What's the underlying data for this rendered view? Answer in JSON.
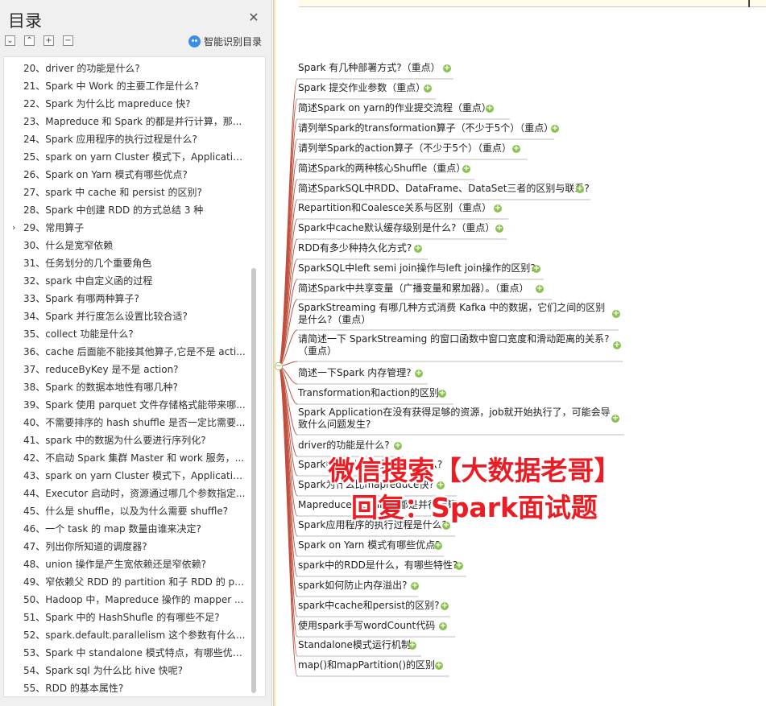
{
  "toc": {
    "title": "目录",
    "close": "✕",
    "toolbar": {
      "collapse_all": "⌄",
      "expand_all": "⌃",
      "expand": "+",
      "collapse": "−"
    },
    "smart_toc": "智能识别目录",
    "items": [
      {
        "label": "20、driver 的功能是什么?"
      },
      {
        "label": "21、Spark 中 Work 的主要工作是什么?"
      },
      {
        "label": "22、Spark 为什么比 mapreduce 快?"
      },
      {
        "label": "23、Mapreduce 和 Spark 的都是并行计算，那..."
      },
      {
        "label": "24、Spark 应用程序的执行过程是什么?"
      },
      {
        "label": "25、spark on yarn Cluster  模式下，Applicatio..."
      },
      {
        "label": "26、Spark on Yarn  模式有哪些优点?"
      },
      {
        "label": "27、spark 中 cache 和 persist 的区别?"
      },
      {
        "label": "28、Spark 中创建 RDD 的方式总结 3 种"
      },
      {
        "label": "29、常用算子",
        "expand": "›"
      },
      {
        "label": "30、什么是宽窄依赖"
      },
      {
        "label": "31、任务划分的几个重要角色"
      },
      {
        "label": "32、spark 中自定义函的过程"
      },
      {
        "label": "33、Spark 有哪两种算子?"
      },
      {
        "label": "34、Spark 并行度怎么设置比较合适?"
      },
      {
        "label": "35、collect 功能是什么?"
      },
      {
        "label": "36、cache 后面能不能接其他算子,它是不是 acti..."
      },
      {
        "label": "37、reduceByKey 是不是 action?"
      },
      {
        "label": "38、Spark 的数据本地性有哪几种?"
      },
      {
        "label": "39、Spark 使用 parquet 文件存储格式能带来哪..."
      },
      {
        "label": "40、不需要排序的 hash shuffle 是否一定比需要..."
      },
      {
        "label": "41、spark 中的数据为什么要进行序列化?"
      },
      {
        "label": "42、不启动 Spark 集群 Master 和 work 服务，..."
      },
      {
        "label": "43、spark on yarn Cluster  模式下，Applicatio..."
      },
      {
        "label": "44、Executor 启动时，资源通过哪几个参数指定..."
      },
      {
        "label": "45、什么是 shuffle，以及为什么需要 shuffle?"
      },
      {
        "label": "46、一个 task 的 map 数量由谁来决定?"
      },
      {
        "label": "47、列出你所知道的调度器?"
      },
      {
        "label": "48、union 操作是产生宽依赖还是窄依赖?"
      },
      {
        "label": "49、窄依赖父 RDD 的 partition 和子 RDD 的 pa..."
      },
      {
        "label": "50、Hadoop 中，Mapreduce 操作的 mapper ..."
      },
      {
        "label": "51、Spark 中的 HashShufle 的有哪些不足?"
      },
      {
        "label": "52、spark.default.parallelism 这个参数有什么..."
      },
      {
        "label": "53、Spark 中 standalone 模式特点，有哪些优点..."
      },
      {
        "label": "54、Spark sql 为什么比 hive 快呢?"
      },
      {
        "label": "55、RDD 的基本属性?"
      }
    ]
  },
  "map": {
    "root_toggle": "−",
    "plus": "+",
    "nodes": [
      {
        "text": "Spark 有几种部署方式?（重点）"
      },
      {
        "text": "Spark 提交作业参数（重点）"
      },
      {
        "text": "简述Spark on yarn的作业提交流程（重点）"
      },
      {
        "text": "请列举Spark的transformation算子（不少于5个）（重点）"
      },
      {
        "text": "请列举Spark的action算子（不少于5个）（重点）"
      },
      {
        "text": "简述Spark的两种核心Shuffle（重点）"
      },
      {
        "text": "简述SparkSQL中RDD、DataFrame、DataSet三者的区别与联系?"
      },
      {
        "text": "Repartition和Coalesce关系与区别（重点）"
      },
      {
        "text": "Spark中cache默认缓存级别是什么?（重点）"
      },
      {
        "text": "RDD有多少种持久化方式?"
      },
      {
        "text": "SparkSQL中left semi join操作与left join操作的区别?"
      },
      {
        "text": "简述Spark中共享变量（广播变量和累加器）。（重点）"
      },
      {
        "text": " SparkStreaming 有哪几种方式消费 Kafka 中的数据，它们之间的区别是什么?（重点）"
      },
      {
        "text": "请简述一下 SparkStreaming 的窗口函数中窗口宽度和滑动距离的关系?（重点）"
      },
      {
        "text": "简述一下Spark 内存管理?"
      },
      {
        "text": "Transformation和action的区别"
      },
      {
        "text": "Spark Application在没有获得足够的资源，job就开始执行了，可能会导致什么问题发生?"
      },
      {
        "text": "driver的功能是什么?"
      },
      {
        "text": "Spark中Work的主要工作是什么?"
      },
      {
        "text": "Spark为什么比mapreduce快?"
      },
      {
        "text": "Mapreduce和Spark的都是并行计算"
      },
      {
        "text": "Spark应用程序的执行过程是什么?"
      },
      {
        "text": "Spark on Yarn 模式有哪些优点?"
      },
      {
        "text": "spark中的RDD是什么，有哪些特性?"
      },
      {
        "text": "spark如何防止内存溢出?"
      },
      {
        "text": "spark中cache和persist的区别?"
      },
      {
        "text": "使用spark手写wordCount代码"
      },
      {
        "text": "Standalone模式运行机制"
      },
      {
        "text": " map()和mapPartition()的区别"
      }
    ]
  },
  "watermark": {
    "line1": "微信搜索【大数据老哥】",
    "line2": "回复：Spark面试题"
  },
  "colors": {
    "accent_green": "#8cc152",
    "watermark_red": "#ea1c24",
    "map_line": "#c0503f"
  }
}
